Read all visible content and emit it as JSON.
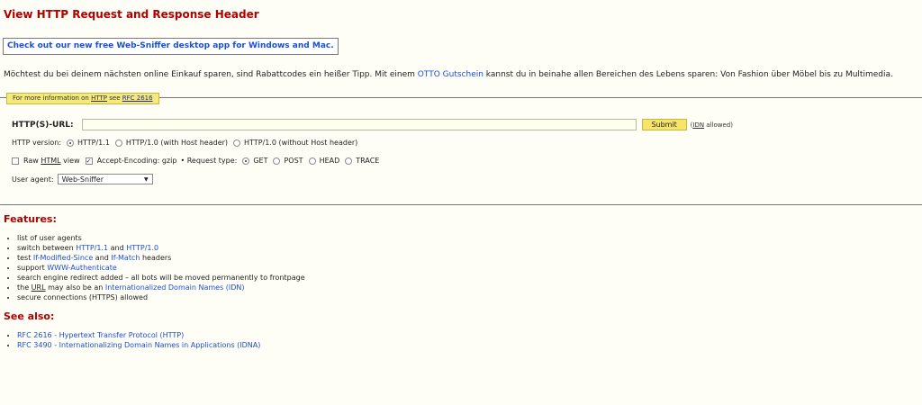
{
  "title": "View HTTP Request and Response Header",
  "promo": "Check out our new free Web-Sniffer desktop app for Windows and Mac.",
  "ad": {
    "before": "Möchtest du bei deinem nächsten online Einkauf sparen, sind Rabattcodes ein heißer Tipp. Mit einem ",
    "link": "OTTO Gutschein",
    "after": " kannst du in beinahe allen Bereichen des Lebens sparen: Von Fashion über Möbel bis zu Multimedia."
  },
  "info_tab": {
    "prefix": "For more information on ",
    "abbr": "HTTP",
    "mid": " see ",
    "link": "RFC 2616"
  },
  "form": {
    "url_label": "HTTP(S)-URL:",
    "url_value": "",
    "submit_label": "Submit",
    "idn_open": "(",
    "idn_abbr": "IDN",
    "idn_rest": " allowed)",
    "http_version_label": "HTTP version:",
    "http_versions": [
      {
        "label": "HTTP/1.1",
        "checked": true
      },
      {
        "label": "HTTP/1.0 (with Host header)",
        "checked": false
      },
      {
        "label": "HTTP/1.0 (without Host header)",
        "checked": false
      }
    ],
    "raw_html_pre": "Raw ",
    "raw_html_abbr": "HTML",
    "raw_html_post": " view",
    "accept_encoding_label": "Accept-Encoding: gzip",
    "request_type_label": "• Request type:",
    "request_types": [
      {
        "label": "GET",
        "checked": true
      },
      {
        "label": "POST",
        "checked": false
      },
      {
        "label": "HEAD",
        "checked": false
      },
      {
        "label": "TRACE",
        "checked": false
      }
    ],
    "user_agent_label": "User agent:",
    "user_agent_value": "Web-Sniffer",
    "select_arrow": "▼"
  },
  "features": {
    "heading": "Features:",
    "items": {
      "f1": "list of user agents",
      "f2_pre": "switch between ",
      "f2_l1": "HTTP/1.1",
      "f2_mid": " and ",
      "f2_l2": "HTTP/1.0",
      "f3_pre": "test ",
      "f3_l1": "If-Modified-Since",
      "f3_mid": " and ",
      "f3_l2": "If-Match",
      "f3_post": " headers",
      "f4_pre": "support ",
      "f4_l1": "WWW-Authenticate",
      "f5": "search engine redirect added – all bots will be moved permanently to frontpage",
      "f6_pre": "the ",
      "f6_abbr": "URL",
      "f6_mid": " may also be an ",
      "f6_l1": "Internationalized Domain Names (IDN)",
      "f7": "secure connections (HTTPS) allowed"
    }
  },
  "see_also": {
    "heading": "See also:",
    "items": [
      "RFC 2616 - Hypertext Transfer Protocol (HTTP)",
      "RFC 3490 - Internationalizing Domain Names in Applications (IDNA)"
    ]
  }
}
